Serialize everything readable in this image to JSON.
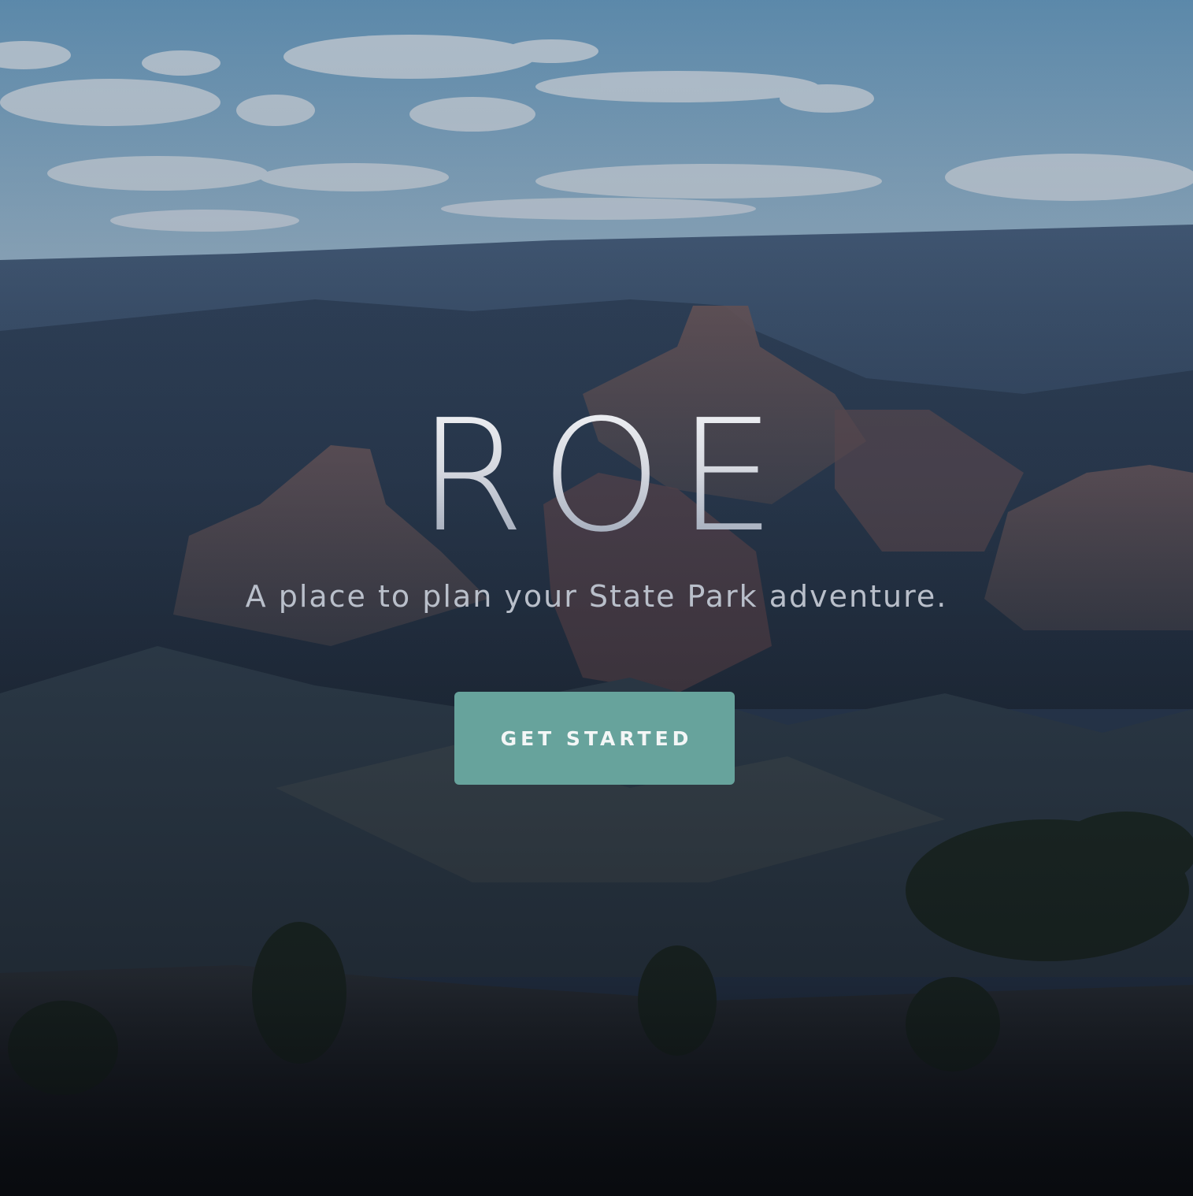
{
  "hero": {
    "title": "ROE",
    "subtitle": "A place to plan your State Park adventure.",
    "cta_label": "GET STARTED",
    "background_image": "canyon-landscape-photo"
  },
  "colors": {
    "accent": "#67a39c",
    "button_text": "#f3f6f6",
    "subtitle_text": "#b9bfca",
    "sky": "#6a9ec0"
  }
}
